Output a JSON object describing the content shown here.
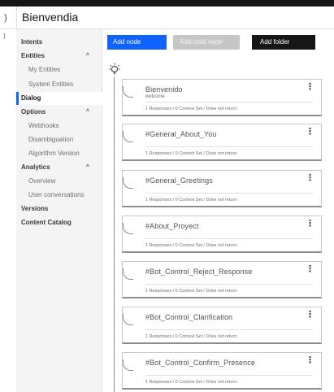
{
  "header": {
    "back_glyph": ")",
    "title": "Bienvendia",
    "edge_glyph": "⁝"
  },
  "sidebar": {
    "items": [
      {
        "label": "Intents",
        "kind": "section"
      },
      {
        "label": "Entities",
        "kind": "section",
        "caret": "^"
      },
      {
        "label": "My Entities",
        "kind": "sub"
      },
      {
        "label": "System Entities",
        "kind": "sub"
      },
      {
        "label": "Dialog",
        "kind": "active"
      },
      {
        "label": "Options",
        "kind": "section",
        "caret": "^"
      },
      {
        "label": "Webhooks",
        "kind": "sub"
      },
      {
        "label": "Disambiguation",
        "kind": "sub"
      },
      {
        "label": "Algorithm Version",
        "kind": "sub"
      },
      {
        "label": "Analytics",
        "kind": "section",
        "caret": "^"
      },
      {
        "label": "Overview",
        "kind": "sub"
      },
      {
        "label": "User conversations",
        "kind": "sub"
      },
      {
        "label": "Versions",
        "kind": "section"
      },
      {
        "label": "Content Catalog",
        "kind": "section"
      }
    ]
  },
  "toolbar": {
    "add_node": "Add node",
    "add_child_node": "Add child node",
    "add_folder": "Add folder"
  },
  "nodes": [
    {
      "title": "Bienvenido",
      "condition": "welcome",
      "status": "1 Responses / 0 Context Set / Does not return"
    },
    {
      "title": "#General_About_You",
      "condition": "",
      "status": "1 Responses / 0 Context Set / Does not return"
    },
    {
      "title": "#General_Greetings",
      "condition": "",
      "status": "1 Responses / 0 Context Set / Does not return"
    },
    {
      "title": "#About_Proyect",
      "condition": "",
      "status": "1 Responses / 0 Context Set / Does not return"
    },
    {
      "title": "#Bot_Control_Reject_Response",
      "condition": "",
      "status": "1 Responses / 0 Context Set / Does not return"
    },
    {
      "title": "#Bot_Control_Clarification",
      "condition": "",
      "status": "1 Responses / 0 Context Set / Does not return"
    },
    {
      "title": "#Bot_Control_Confirm_Presence",
      "condition": "",
      "status": "1 Responses / 0 Context Set / Does not return"
    }
  ],
  "node_menu_glyph": "⋮",
  "colors": {
    "primary": "#0f62fe",
    "disabled": "#c6c6c6",
    "dark": "#161616",
    "sidebar_bg": "#f4f4f4"
  },
  "icons": {
    "bulb": "lightbulb-icon",
    "overflow": "overflow-menu-icon"
  }
}
